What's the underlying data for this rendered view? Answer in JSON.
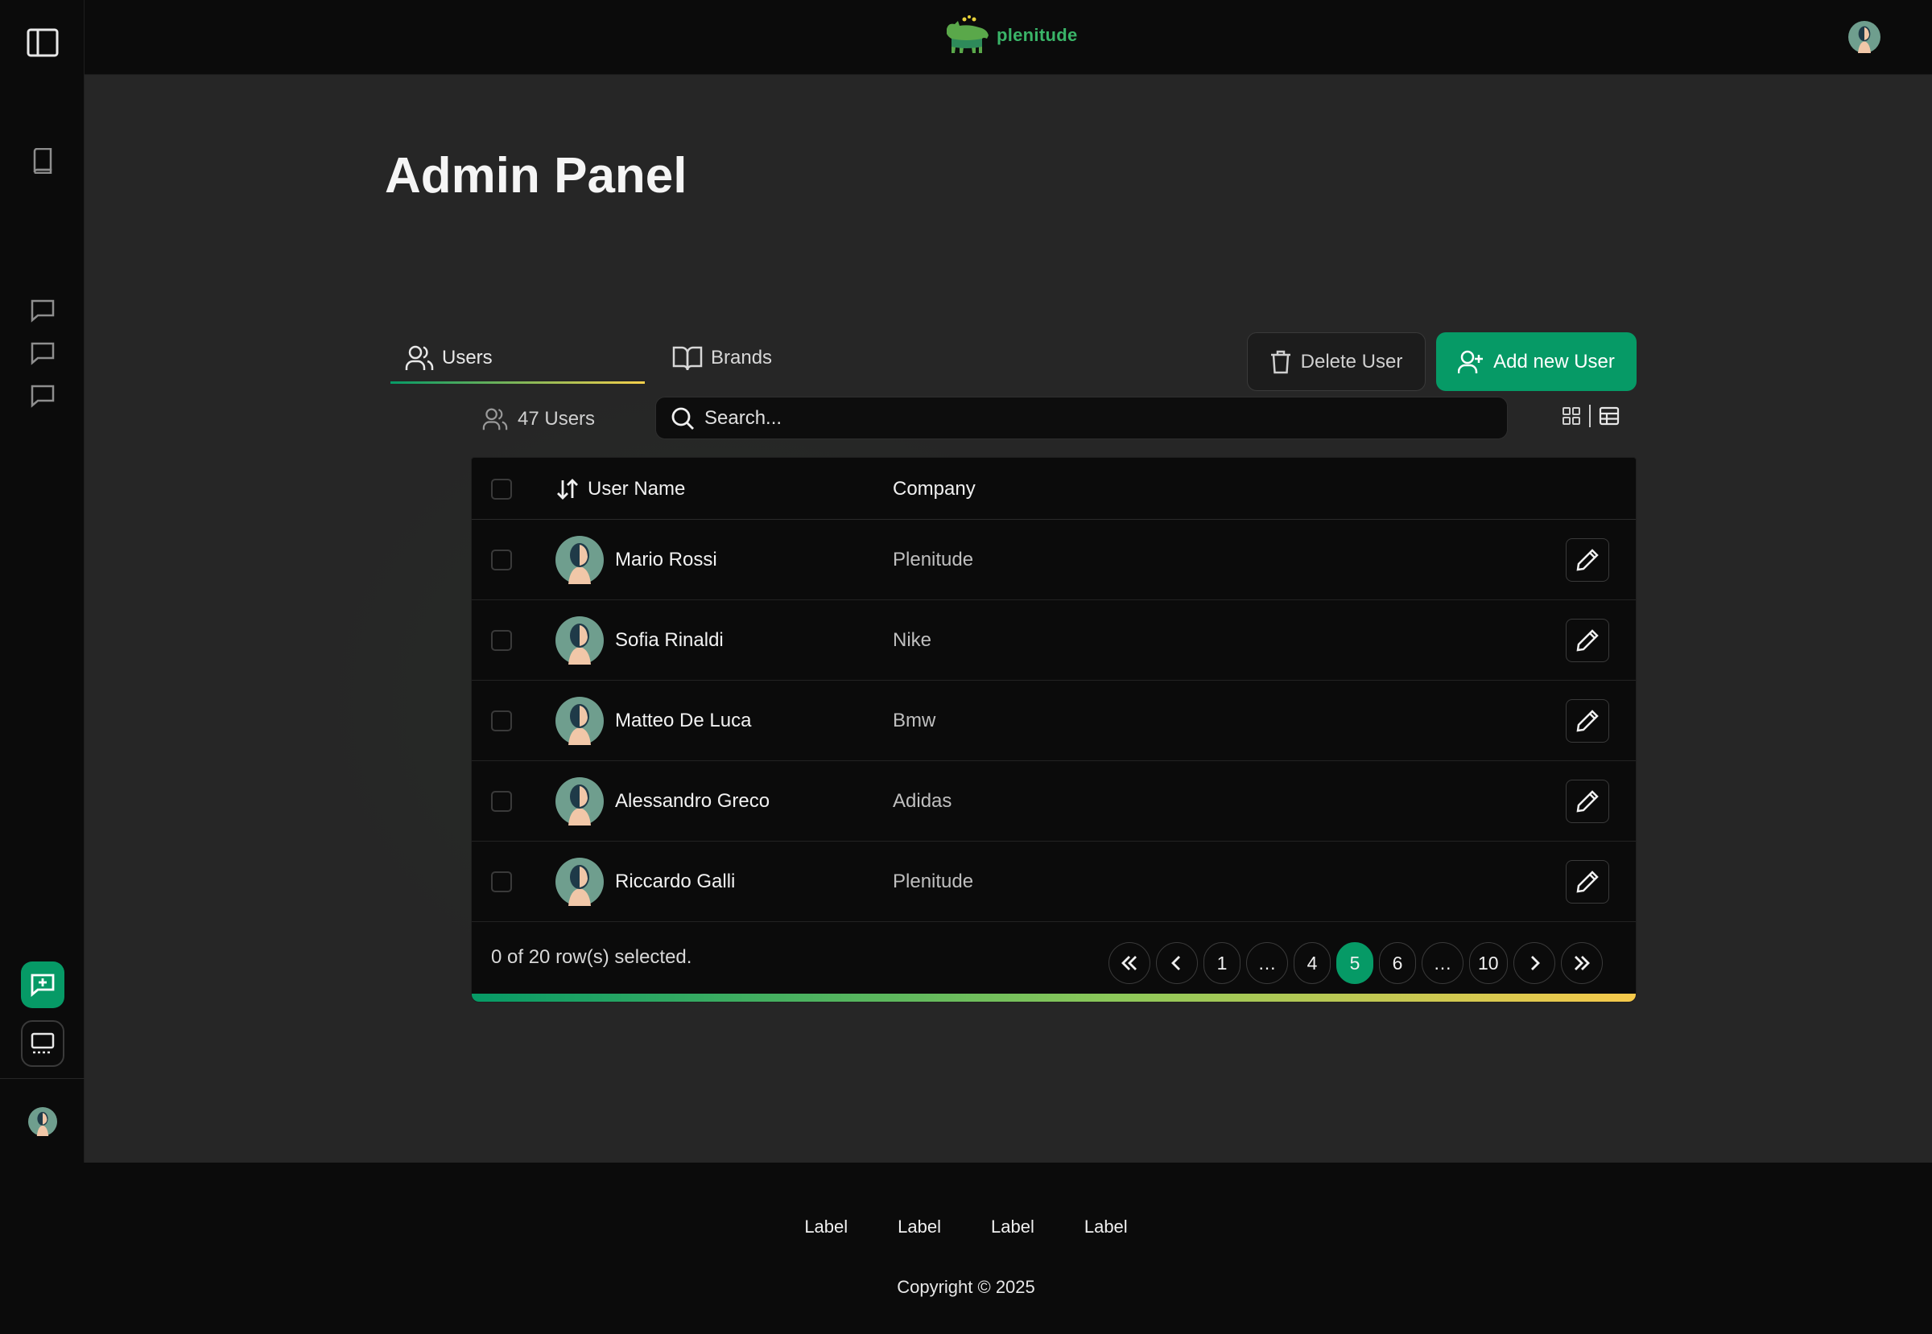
{
  "app": {
    "brand": "plenitude",
    "colors": {
      "accent": "#069a66",
      "gradient_end": "#f6c94b",
      "background": "#262626",
      "surface": "#0b0b0b"
    }
  },
  "sidebar": {
    "items": [
      {
        "icon": "sidebar-toggle-icon"
      },
      {
        "icon": "book-icon"
      },
      {
        "icon": "chat-icon"
      },
      {
        "icon": "chat-icon"
      },
      {
        "icon": "chat-icon"
      },
      {
        "icon": "new-chat-icon"
      },
      {
        "icon": "monitor-icon"
      },
      {
        "icon": "avatar"
      }
    ]
  },
  "page": {
    "title": "Admin Panel",
    "tabs": [
      {
        "label": "Users",
        "icon": "users-icon",
        "active": true
      },
      {
        "label": "Brands",
        "icon": "book-open-icon",
        "active": false
      }
    ],
    "actions": {
      "delete_label": "Delete User",
      "add_label": "Add new User"
    },
    "user_count": "47 Users",
    "search": {
      "placeholder": "Search...",
      "value": ""
    }
  },
  "table": {
    "columns": [
      "User Name",
      "Company"
    ],
    "rows": [
      {
        "name": "Mario Rossi",
        "company": "Plenitude"
      },
      {
        "name": "Sofia Rinaldi",
        "company": "Nike"
      },
      {
        "name": "Matteo De Luca",
        "company": "Bmw"
      },
      {
        "name": "Alessandro Greco",
        "company": "Adidas"
      },
      {
        "name": "Riccardo Galli",
        "company": "Plenitude"
      }
    ],
    "selection": "0 of 20 row(s) selected.",
    "pagination": {
      "pages": [
        "1",
        "…",
        "4",
        "5",
        "6",
        "…",
        "10"
      ],
      "current": "5"
    }
  },
  "footer": {
    "links": [
      "Label",
      "Label",
      "Label",
      "Label"
    ],
    "copyright": "Copyright © 2025"
  }
}
